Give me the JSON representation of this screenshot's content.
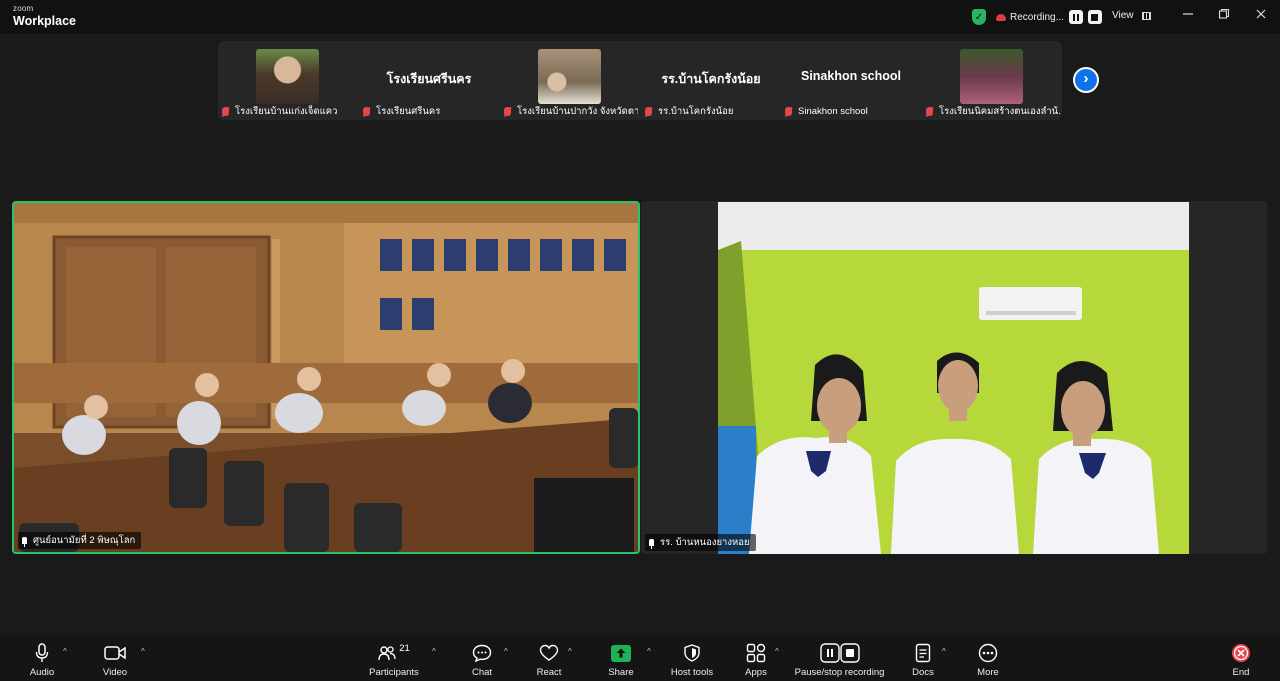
{
  "app": {
    "brand_top": "zoom",
    "brand_bottom": "Workplace"
  },
  "recording": {
    "label": "Recording..."
  },
  "view": {
    "label": "View"
  },
  "thumbnails": [
    {
      "label": "โรงเรียนบ้านแก่งเจ็ดแคว",
      "has_video": true,
      "color": "#7a6a52"
    },
    {
      "label": "โรงเรียนศรีนคร",
      "name_display": "โรงเรียนศรีนคร",
      "has_video": false
    },
    {
      "label": "โรงเรียนบ้านปากวัง จังหวัดตาก",
      "has_video": true,
      "color": "#8b7a62"
    },
    {
      "label": "รร.บ้านโคกรังน้อย",
      "name_display": "รร.บ้านโคกรังน้อย",
      "has_video": false
    },
    {
      "label": "Sinakhon school",
      "name_display": "Sinakhon school",
      "has_video": false
    },
    {
      "label": "โรงเรียนนิคมสร้างตนเองลำน้...",
      "has_video": true,
      "color": "#7a4a5a"
    }
  ],
  "videos": {
    "left_label": "ศูนย์อนามัยที่ 2 พิษณุโลก",
    "right_label": "รร. บ้านหนองยางหอย"
  },
  "toolbar": {
    "audio": "Audio",
    "video": "Video",
    "participants": "Participants",
    "participants_count": "21",
    "chat": "Chat",
    "react": "React",
    "share": "Share",
    "host_tools": "Host tools",
    "apps": "Apps",
    "pause_stop_recording": "Pause/stop recording",
    "docs": "Docs",
    "more": "More",
    "end": "End"
  },
  "colors": {
    "accent": "#0e72ed",
    "share_green": "#1fb155",
    "end_red": "#e5474b",
    "active_speaker": "#27c56b"
  }
}
